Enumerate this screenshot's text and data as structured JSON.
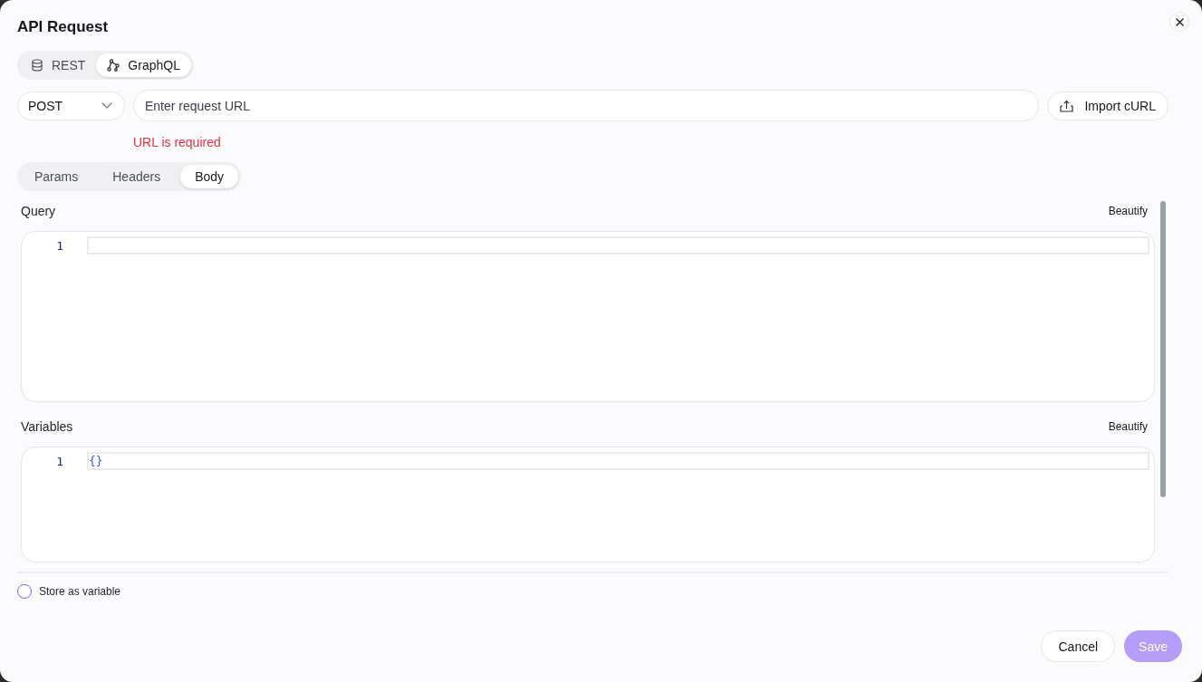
{
  "dialog": {
    "title": "API Request"
  },
  "mode_tabs": [
    {
      "label": "REST",
      "selected": false
    },
    {
      "label": "GraphQL",
      "selected": true
    }
  ],
  "request": {
    "method": "POST",
    "url": {
      "placeholder": "Enter request URL"
    },
    "error": "URL is required",
    "import_button": "Import cURL"
  },
  "body_tabs": [
    {
      "label": "Params",
      "selected": false
    },
    {
      "label": "Headers",
      "selected": false
    },
    {
      "label": "Body",
      "selected": true
    }
  ],
  "editors": [
    {
      "label": "Query",
      "action": "Beautify",
      "lines": [
        {
          "number": "1",
          "active": true
        }
      ]
    },
    {
      "label": "Variables",
      "action": "Beautify",
      "lines": [
        {
          "number": "1",
          "code": "{}",
          "active": true
        }
      ]
    }
  ],
  "store_as_variable": {
    "label": "Store as variable",
    "checked": false
  },
  "footer_buttons": [
    {
      "label": "Cancel",
      "kind": "secondary",
      "disabled": false
    },
    {
      "label": "Save",
      "kind": "primary",
      "disabled": true
    }
  ]
}
